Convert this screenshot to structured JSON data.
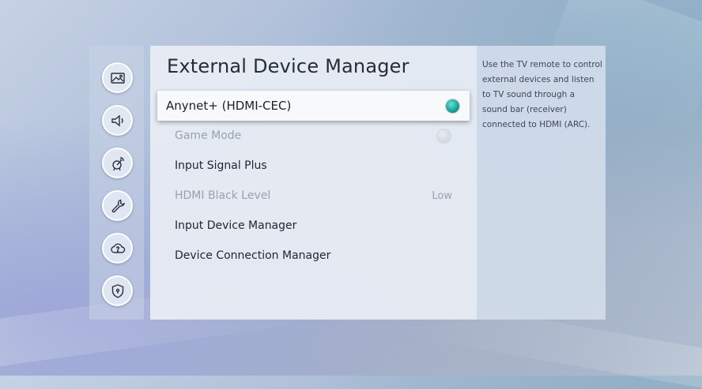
{
  "screen": {
    "title": "External Device Manager",
    "help_text": "Use the TV remote to control external devices and listen to TV sound through a sound bar (receiver) connected to HDMI (ARC)."
  },
  "sidebar": {
    "items": [
      {
        "icon": "picture-icon"
      },
      {
        "icon": "sound-icon"
      },
      {
        "icon": "broadcasting-icon"
      },
      {
        "icon": "general-wrench-icon"
      },
      {
        "icon": "support-cloud-icon"
      },
      {
        "icon": "privacy-shield-icon"
      }
    ]
  },
  "menu": {
    "items": [
      {
        "label": "Anynet+ (HDMI-CEC)",
        "state": "on",
        "focused": true,
        "enabled": true
      },
      {
        "label": "Game Mode",
        "state": "off",
        "enabled": false
      },
      {
        "label": "Input Signal Plus",
        "enabled": true
      },
      {
        "label": "HDMI Black Level",
        "value": "Low",
        "enabled": false
      },
      {
        "label": "Input Device Manager",
        "enabled": true
      },
      {
        "label": "Device Connection Manager",
        "enabled": true
      }
    ]
  },
  "colors": {
    "toggle_on": "#1aa59a",
    "focus_bg": "#f8f9fb",
    "panel_bg": "#e8edf4"
  }
}
